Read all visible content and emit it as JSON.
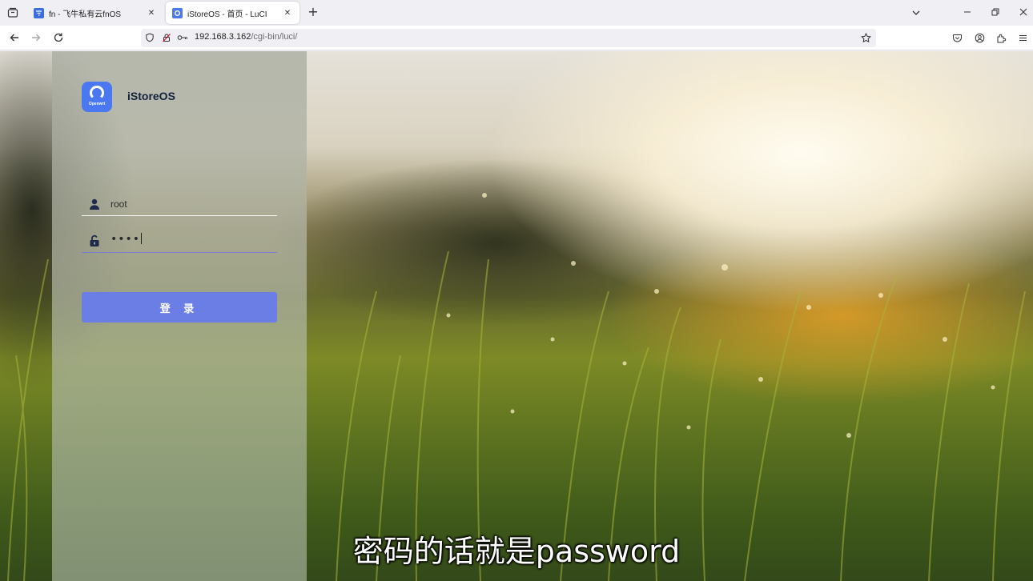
{
  "browser": {
    "tabs": [
      {
        "title": "fn - 飞牛私有云fnOS",
        "active": false,
        "favicon": "fnos-favicon",
        "favicon_color": "#3b6fe0"
      },
      {
        "title": "iStoreOS - 首页 - LuCI",
        "active": true,
        "favicon": "istoreos-favicon",
        "favicon_color": "#4a78f0"
      }
    ],
    "url": {
      "host": "192.168.3.162",
      "path": "/cgi-bin/luci/"
    }
  },
  "login": {
    "brand": "iStoreOS",
    "logo_caption": "Openwrt",
    "username": "root",
    "password_mask": "••••",
    "submit_label": "登 录",
    "accent_color": "#6b7ee6"
  },
  "subtitle": "密码的话就是password"
}
